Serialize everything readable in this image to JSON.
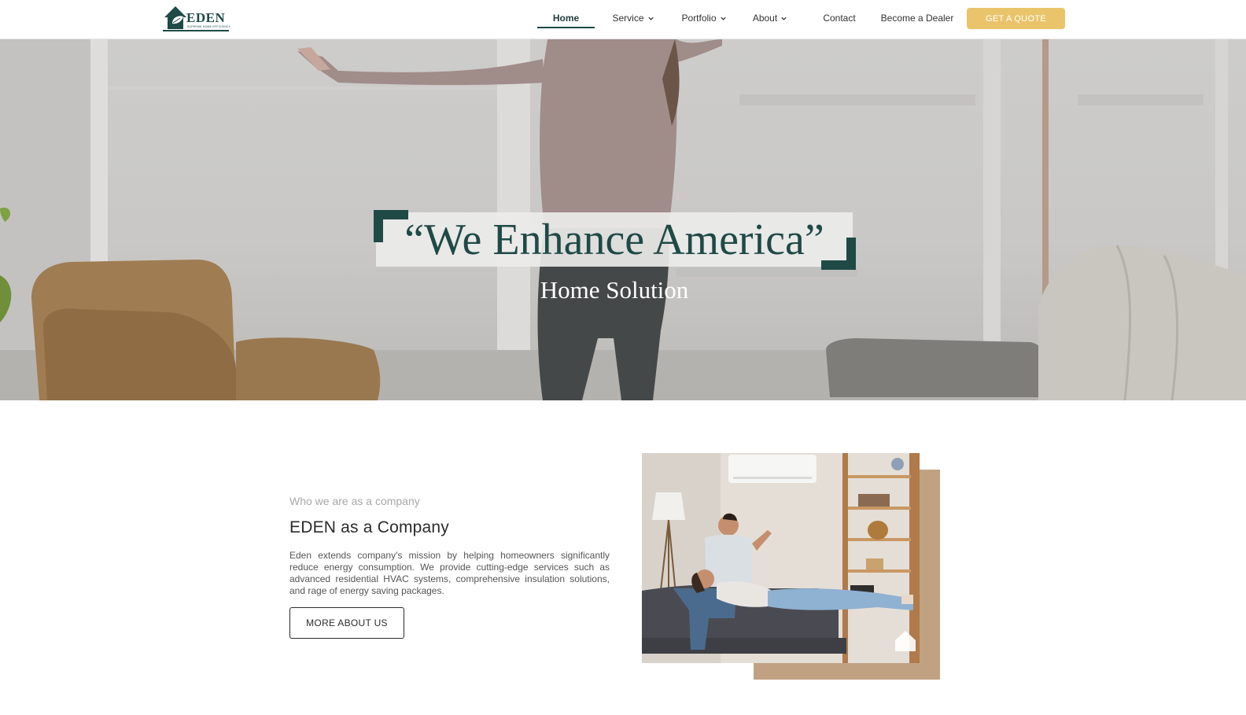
{
  "brand": {
    "name": "EDEN",
    "tagline": "SUPREME HOME EFFICIENCY"
  },
  "nav": {
    "items": [
      {
        "label": "Home",
        "has_dropdown": false,
        "active": true
      },
      {
        "label": "Service",
        "has_dropdown": true
      },
      {
        "label": "Portfolio",
        "has_dropdown": true
      },
      {
        "label": "About",
        "has_dropdown": true
      },
      {
        "label": "Contact",
        "has_dropdown": false
      },
      {
        "label": "Become a Dealer",
        "has_dropdown": false
      }
    ],
    "cta_label": "GET A QUOTE"
  },
  "hero": {
    "title": "“We Enhance America”",
    "subtitle": "Home Solution"
  },
  "about": {
    "eyebrow": "Who we are as a company",
    "title": "EDEN as a Company",
    "body": "Eden extends company's mission by helping homeowners significantly reduce energy consumption. We provide cutting-edge services such as advanced residential HVAC systems, comprehensive insulation solutions, and rage of energy saving packages.",
    "button_label": "MORE ABOUT US"
  },
  "colors": {
    "brand_green": "#1f4a46",
    "cta_yellow": "#e9c46a",
    "accent_tan": "#c0a283"
  },
  "icons": {
    "dropdown": "chevron-down-icon",
    "logo": "eden-house-leaf-logo"
  }
}
